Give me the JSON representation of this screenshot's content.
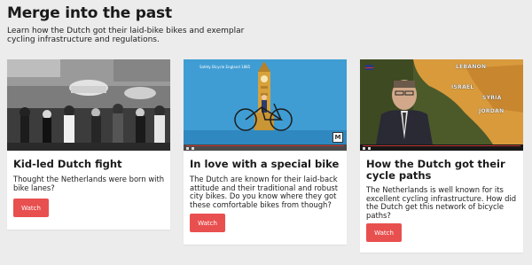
{
  "section": {
    "title": "Merge into the past",
    "intro": "Learn how the Dutch got their laid-bike bikes and exemplar cycling infrastructure and regulations."
  },
  "cards": [
    {
      "title": "Kid-led Dutch fight",
      "description": "Thought the Netherlands were born with bike lanes?",
      "button": "Watch",
      "thumbnail_icon": "historic-street-photo"
    },
    {
      "title": "In love with a special bike",
      "description": "The Dutch are known for their laid-back attitude and their traditional and robust city bikes. Do you know where they got these comfortable bikes from though?",
      "button": "Watch",
      "thumbnail_icon": "bicycle-illustration",
      "poster_text": "Safety Bicycle England 1885",
      "badge": "M"
    },
    {
      "title": "How the Dutch got their cycle paths",
      "description": "The Netherlands is well known for its excellent cycling infrastructure. How did the Dutch get this network of bicycle paths?",
      "button": "Watch",
      "thumbnail_icon": "news-anchor-video",
      "map_labels": [
        "LEBANON",
        "ISRAEL",
        "SYRIA",
        "JORDAN"
      ]
    }
  ],
  "colors": {
    "page_background": "#ececec",
    "card_background": "#ffffff",
    "button": "#e8504f",
    "illustration_sky": "#3f9dd4",
    "map_land": "#d99a3c"
  }
}
